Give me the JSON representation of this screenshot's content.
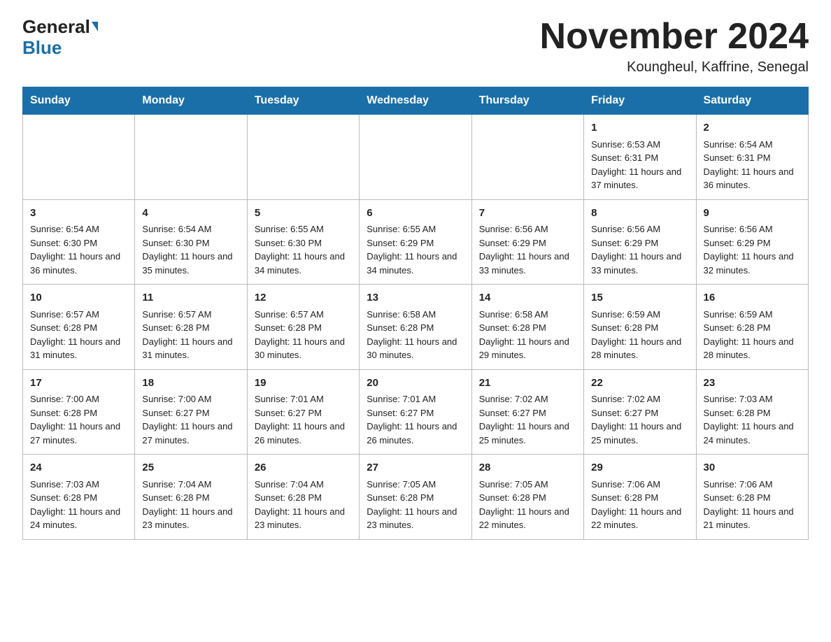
{
  "header": {
    "logo_general": "General",
    "logo_blue": "Blue",
    "title": "November 2024",
    "location": "Koungheul, Kaffrine, Senegal"
  },
  "days_of_week": [
    "Sunday",
    "Monday",
    "Tuesday",
    "Wednesday",
    "Thursday",
    "Friday",
    "Saturday"
  ],
  "weeks": [
    [
      {
        "day": "",
        "sunrise": "",
        "sunset": "",
        "daylight": ""
      },
      {
        "day": "",
        "sunrise": "",
        "sunset": "",
        "daylight": ""
      },
      {
        "day": "",
        "sunrise": "",
        "sunset": "",
        "daylight": ""
      },
      {
        "day": "",
        "sunrise": "",
        "sunset": "",
        "daylight": ""
      },
      {
        "day": "",
        "sunrise": "",
        "sunset": "",
        "daylight": ""
      },
      {
        "day": "1",
        "sunrise": "Sunrise: 6:53 AM",
        "sunset": "Sunset: 6:31 PM",
        "daylight": "Daylight: 11 hours and 37 minutes."
      },
      {
        "day": "2",
        "sunrise": "Sunrise: 6:54 AM",
        "sunset": "Sunset: 6:31 PM",
        "daylight": "Daylight: 11 hours and 36 minutes."
      }
    ],
    [
      {
        "day": "3",
        "sunrise": "Sunrise: 6:54 AM",
        "sunset": "Sunset: 6:30 PM",
        "daylight": "Daylight: 11 hours and 36 minutes."
      },
      {
        "day": "4",
        "sunrise": "Sunrise: 6:54 AM",
        "sunset": "Sunset: 6:30 PM",
        "daylight": "Daylight: 11 hours and 35 minutes."
      },
      {
        "day": "5",
        "sunrise": "Sunrise: 6:55 AM",
        "sunset": "Sunset: 6:30 PM",
        "daylight": "Daylight: 11 hours and 34 minutes."
      },
      {
        "day": "6",
        "sunrise": "Sunrise: 6:55 AM",
        "sunset": "Sunset: 6:29 PM",
        "daylight": "Daylight: 11 hours and 34 minutes."
      },
      {
        "day": "7",
        "sunrise": "Sunrise: 6:56 AM",
        "sunset": "Sunset: 6:29 PM",
        "daylight": "Daylight: 11 hours and 33 minutes."
      },
      {
        "day": "8",
        "sunrise": "Sunrise: 6:56 AM",
        "sunset": "Sunset: 6:29 PM",
        "daylight": "Daylight: 11 hours and 33 minutes."
      },
      {
        "day": "9",
        "sunrise": "Sunrise: 6:56 AM",
        "sunset": "Sunset: 6:29 PM",
        "daylight": "Daylight: 11 hours and 32 minutes."
      }
    ],
    [
      {
        "day": "10",
        "sunrise": "Sunrise: 6:57 AM",
        "sunset": "Sunset: 6:28 PM",
        "daylight": "Daylight: 11 hours and 31 minutes."
      },
      {
        "day": "11",
        "sunrise": "Sunrise: 6:57 AM",
        "sunset": "Sunset: 6:28 PM",
        "daylight": "Daylight: 11 hours and 31 minutes."
      },
      {
        "day": "12",
        "sunrise": "Sunrise: 6:57 AM",
        "sunset": "Sunset: 6:28 PM",
        "daylight": "Daylight: 11 hours and 30 minutes."
      },
      {
        "day": "13",
        "sunrise": "Sunrise: 6:58 AM",
        "sunset": "Sunset: 6:28 PM",
        "daylight": "Daylight: 11 hours and 30 minutes."
      },
      {
        "day": "14",
        "sunrise": "Sunrise: 6:58 AM",
        "sunset": "Sunset: 6:28 PM",
        "daylight": "Daylight: 11 hours and 29 minutes."
      },
      {
        "day": "15",
        "sunrise": "Sunrise: 6:59 AM",
        "sunset": "Sunset: 6:28 PM",
        "daylight": "Daylight: 11 hours and 28 minutes."
      },
      {
        "day": "16",
        "sunrise": "Sunrise: 6:59 AM",
        "sunset": "Sunset: 6:28 PM",
        "daylight": "Daylight: 11 hours and 28 minutes."
      }
    ],
    [
      {
        "day": "17",
        "sunrise": "Sunrise: 7:00 AM",
        "sunset": "Sunset: 6:28 PM",
        "daylight": "Daylight: 11 hours and 27 minutes."
      },
      {
        "day": "18",
        "sunrise": "Sunrise: 7:00 AM",
        "sunset": "Sunset: 6:27 PM",
        "daylight": "Daylight: 11 hours and 27 minutes."
      },
      {
        "day": "19",
        "sunrise": "Sunrise: 7:01 AM",
        "sunset": "Sunset: 6:27 PM",
        "daylight": "Daylight: 11 hours and 26 minutes."
      },
      {
        "day": "20",
        "sunrise": "Sunrise: 7:01 AM",
        "sunset": "Sunset: 6:27 PM",
        "daylight": "Daylight: 11 hours and 26 minutes."
      },
      {
        "day": "21",
        "sunrise": "Sunrise: 7:02 AM",
        "sunset": "Sunset: 6:27 PM",
        "daylight": "Daylight: 11 hours and 25 minutes."
      },
      {
        "day": "22",
        "sunrise": "Sunrise: 7:02 AM",
        "sunset": "Sunset: 6:27 PM",
        "daylight": "Daylight: 11 hours and 25 minutes."
      },
      {
        "day": "23",
        "sunrise": "Sunrise: 7:03 AM",
        "sunset": "Sunset: 6:28 PM",
        "daylight": "Daylight: 11 hours and 24 minutes."
      }
    ],
    [
      {
        "day": "24",
        "sunrise": "Sunrise: 7:03 AM",
        "sunset": "Sunset: 6:28 PM",
        "daylight": "Daylight: 11 hours and 24 minutes."
      },
      {
        "day": "25",
        "sunrise": "Sunrise: 7:04 AM",
        "sunset": "Sunset: 6:28 PM",
        "daylight": "Daylight: 11 hours and 23 minutes."
      },
      {
        "day": "26",
        "sunrise": "Sunrise: 7:04 AM",
        "sunset": "Sunset: 6:28 PM",
        "daylight": "Daylight: 11 hours and 23 minutes."
      },
      {
        "day": "27",
        "sunrise": "Sunrise: 7:05 AM",
        "sunset": "Sunset: 6:28 PM",
        "daylight": "Daylight: 11 hours and 23 minutes."
      },
      {
        "day": "28",
        "sunrise": "Sunrise: 7:05 AM",
        "sunset": "Sunset: 6:28 PM",
        "daylight": "Daylight: 11 hours and 22 minutes."
      },
      {
        "day": "29",
        "sunrise": "Sunrise: 7:06 AM",
        "sunset": "Sunset: 6:28 PM",
        "daylight": "Daylight: 11 hours and 22 minutes."
      },
      {
        "day": "30",
        "sunrise": "Sunrise: 7:06 AM",
        "sunset": "Sunset: 6:28 PM",
        "daylight": "Daylight: 11 hours and 21 minutes."
      }
    ]
  ]
}
